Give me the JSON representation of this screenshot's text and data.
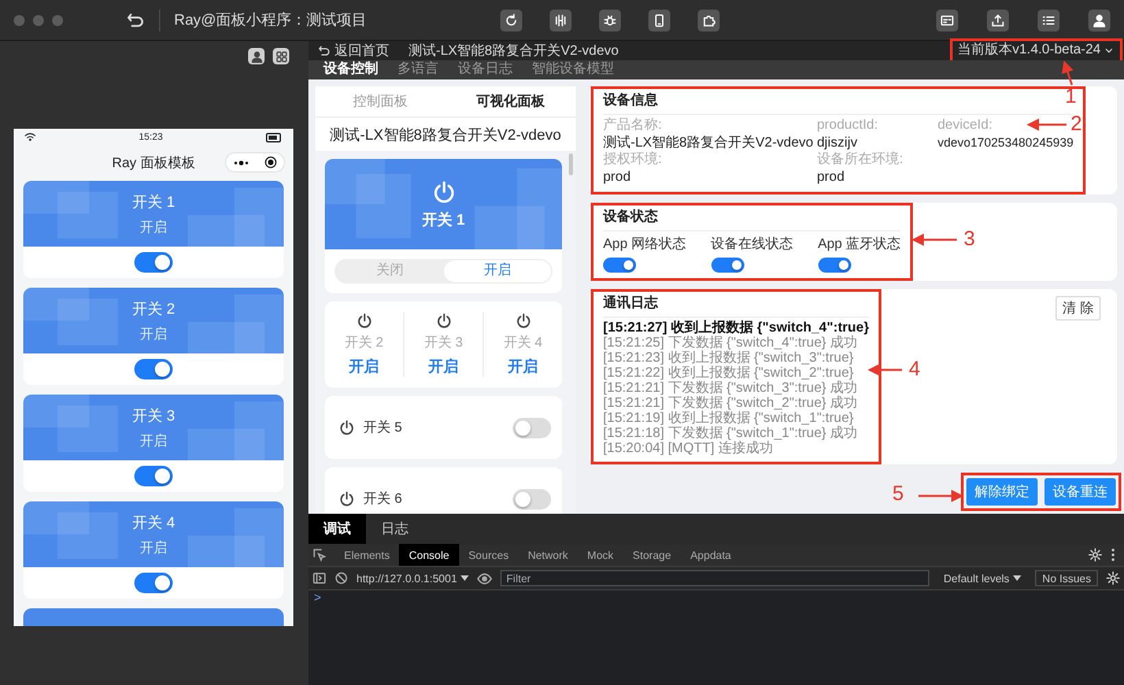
{
  "window": {
    "title": "Ray@面板小程序：测试项目"
  },
  "simulator": {
    "status_time": "15:23",
    "title": "Ray 面板模板",
    "switches": [
      {
        "name": "开关 1",
        "status": "开启",
        "on": true
      },
      {
        "name": "开关 2",
        "status": "开启",
        "on": true
      },
      {
        "name": "开关 3",
        "status": "开启",
        "on": true
      },
      {
        "name": "开关 4",
        "status": "开启",
        "on": true
      }
    ]
  },
  "header": {
    "back_label": "返回首页",
    "device_title": "测试-LX智能8路复合开关V2-vdevo",
    "version": "当前版本v1.4.0-beta-24",
    "annotated": true
  },
  "section_tabs": [
    {
      "label": "设备控制",
      "selected": true
    },
    {
      "label": "多语言",
      "selected": false
    },
    {
      "label": "设备日志",
      "selected": false
    },
    {
      "label": "智能设备模型",
      "selected": false
    }
  ],
  "preview": {
    "tabs": [
      {
        "label": "控制面板",
        "selected": false
      },
      {
        "label": "可视化面板",
        "selected": true
      }
    ],
    "title": "测试-LX智能8路复合开关V2-vdevo",
    "main_switch": {
      "name": "开关 1",
      "options": [
        {
          "label": "关闭",
          "selected": false
        },
        {
          "label": "开启",
          "selected": true
        }
      ]
    },
    "grid_switches": [
      {
        "name": "开关 2",
        "status": "开启"
      },
      {
        "name": "开关 3",
        "status": "开启"
      },
      {
        "name": "开关 4",
        "status": "开启"
      }
    ],
    "row_switches": [
      {
        "name": "开关 5",
        "on": false
      },
      {
        "name": "开关 6",
        "on": false
      }
    ]
  },
  "device_info": {
    "title": "设备信息",
    "annotated": true,
    "fields": [
      {
        "label": "产品名称:",
        "value": "测试-LX智能8路复合开关V2-vdevo"
      },
      {
        "label": "productId:",
        "value": "djiszijv"
      },
      {
        "label": "deviceId:",
        "value": "vdevo170253480245939"
      },
      {
        "label": "授权环境:",
        "value": "prod"
      },
      {
        "label": "设备所在环境:",
        "value": "prod"
      }
    ]
  },
  "device_status": {
    "title": "设备状态",
    "annotated": true,
    "items": [
      {
        "label": "App 网络状态",
        "on": true
      },
      {
        "label": "设备在线状态",
        "on": true
      },
      {
        "label": "App 蓝牙状态",
        "on": true
      }
    ]
  },
  "comm_log": {
    "title": "通讯日志",
    "clear_button": "清 除",
    "annotated": true,
    "lines": [
      {
        "text": "[15:21:27] 收到上报数据 {\"switch_4\":true}",
        "latest": true
      },
      {
        "text": "[15:21:25] 下发数据 {\"switch_4\":true} 成功",
        "latest": false
      },
      {
        "text": "[15:21:23] 收到上报数据 {\"switch_3\":true}",
        "latest": false
      },
      {
        "text": "[15:21:22] 收到上报数据 {\"switch_2\":true}",
        "latest": false
      },
      {
        "text": "[15:21:21] 下发数据 {\"switch_3\":true} 成功",
        "latest": false
      },
      {
        "text": "[15:21:21] 下发数据 {\"switch_2\":true} 成功",
        "latest": false
      },
      {
        "text": "[15:21:19] 收到上报数据 {\"switch_1\":true}",
        "latest": false
      },
      {
        "text": "[15:21:18] 下发数据 {\"switch_1\":true} 成功",
        "latest": false
      },
      {
        "text": "[15:20:04] [MQTT] 连接成功",
        "latest": false
      }
    ]
  },
  "actions": {
    "annotated": true,
    "buttons": [
      "解除绑定",
      "设备重连"
    ]
  },
  "annotations": [
    "1",
    "2",
    "3",
    "4",
    "5"
  ],
  "devtools": {
    "tabs": [
      {
        "label": "调试",
        "selected": true
      },
      {
        "label": "日志",
        "selected": false
      }
    ],
    "panels": [
      {
        "label": "Elements",
        "selected": false
      },
      {
        "label": "Console",
        "selected": true
      },
      {
        "label": "Sources",
        "selected": false
      },
      {
        "label": "Network",
        "selected": false
      },
      {
        "label": "Mock",
        "selected": false
      },
      {
        "label": "Storage",
        "selected": false
      },
      {
        "label": "Appdata",
        "selected": false
      }
    ],
    "context": "http://127.0.0.1:5001",
    "filter_placeholder": "Filter",
    "levels": "Default levels",
    "issues": "No Issues",
    "prompt": ">"
  }
}
